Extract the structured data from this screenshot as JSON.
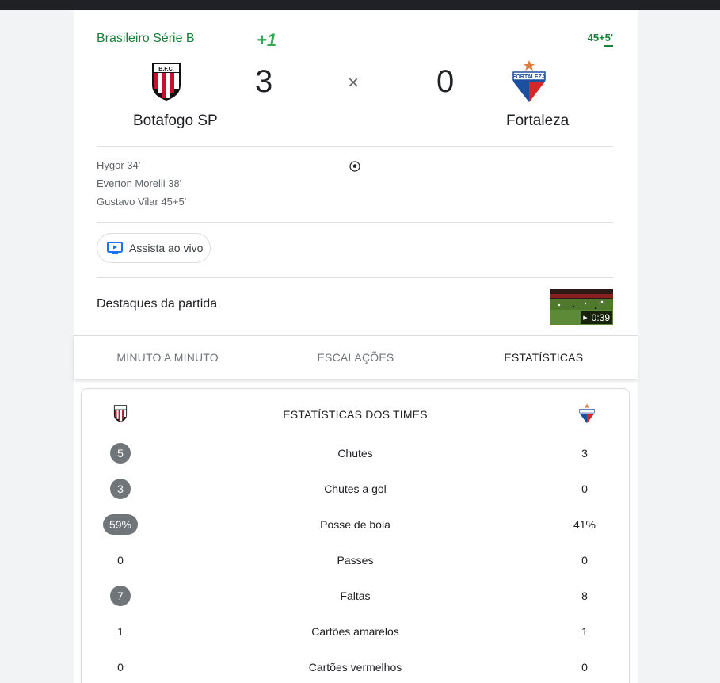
{
  "match": {
    "league": "Brasileiro Série B",
    "score_change": "+1",
    "live_time": "45+5'",
    "home": {
      "name": "Botafogo SP",
      "score": "3",
      "crest_text": "B.F.C."
    },
    "away": {
      "name": "Fortaleza",
      "score": "0",
      "crest_text": "FORTALEZA"
    },
    "separator": "×",
    "scorers_home": [
      "Hygor 34'",
      "Everton Morelli 38'",
      "Gustavo Vilar 45+5'"
    ]
  },
  "watch": {
    "label": "Assista ao vivo"
  },
  "highlights": {
    "label": "Destaques da partida",
    "duration": "0:39"
  },
  "tabs": [
    {
      "label": "MINUTO A MINUTO",
      "active": false
    },
    {
      "label": "ESCALAÇÕES",
      "active": false
    },
    {
      "label": "ESTATÍSTICAS",
      "active": true
    }
  ],
  "stats": {
    "title": "ESTATÍSTICAS DOS TIMES",
    "rows": [
      {
        "label": "Chutes",
        "home": "5",
        "away": "3",
        "home_leads": true
      },
      {
        "label": "Chutes a gol",
        "home": "3",
        "away": "0",
        "home_leads": true
      },
      {
        "label": "Posse de bola",
        "home": "59%",
        "away": "41%",
        "home_leads": true
      },
      {
        "label": "Passes",
        "home": "0",
        "away": "0",
        "home_leads": false
      },
      {
        "label": "Faltas",
        "home": "7",
        "away": "8",
        "home_leads": true
      },
      {
        "label": "Cartões amarelos",
        "home": "1",
        "away": "1",
        "home_leads": false
      },
      {
        "label": "Cartões vermelhos",
        "home": "0",
        "away": "0",
        "home_leads": false
      }
    ]
  },
  "colors": {
    "accent_green": "#188038",
    "pill_gray": "#70757a",
    "home_red": "#c8102e",
    "away_blue": "#1b4fa0",
    "away_red": "#d7262b"
  }
}
